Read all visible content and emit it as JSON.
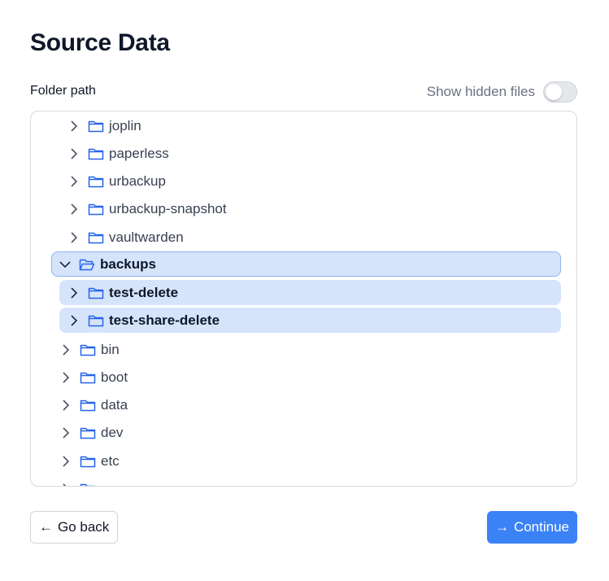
{
  "title": "Source Data",
  "folder_path_label": "Folder path",
  "hidden_files": {
    "label": "Show hidden files",
    "enabled": false
  },
  "tree": {
    "items": [
      {
        "name": "joplin",
        "expanded": false
      },
      {
        "name": "paperless",
        "expanded": false
      },
      {
        "name": "urbackup",
        "expanded": false
      },
      {
        "name": "urbackup-snapshot",
        "expanded": false
      },
      {
        "name": "vaultwarden",
        "expanded": false
      },
      {
        "name": "backups",
        "expanded": true,
        "selected": true
      },
      {
        "name": "test-delete",
        "expanded": false,
        "selected": true
      },
      {
        "name": "test-share-delete",
        "expanded": false,
        "selected": true
      },
      {
        "name": "bin",
        "expanded": false
      },
      {
        "name": "boot",
        "expanded": false
      },
      {
        "name": "data",
        "expanded": false
      },
      {
        "name": "dev",
        "expanded": false
      },
      {
        "name": "etc",
        "expanded": false
      }
    ]
  },
  "buttons": {
    "back_arrow": "←",
    "back_label": "Go back",
    "continue_arrow": "→",
    "continue_label": "Continue"
  },
  "colors": {
    "accent": "#3b82f6",
    "selection_bg": "#d6e4fb",
    "selection_border": "#8fb3ef"
  }
}
